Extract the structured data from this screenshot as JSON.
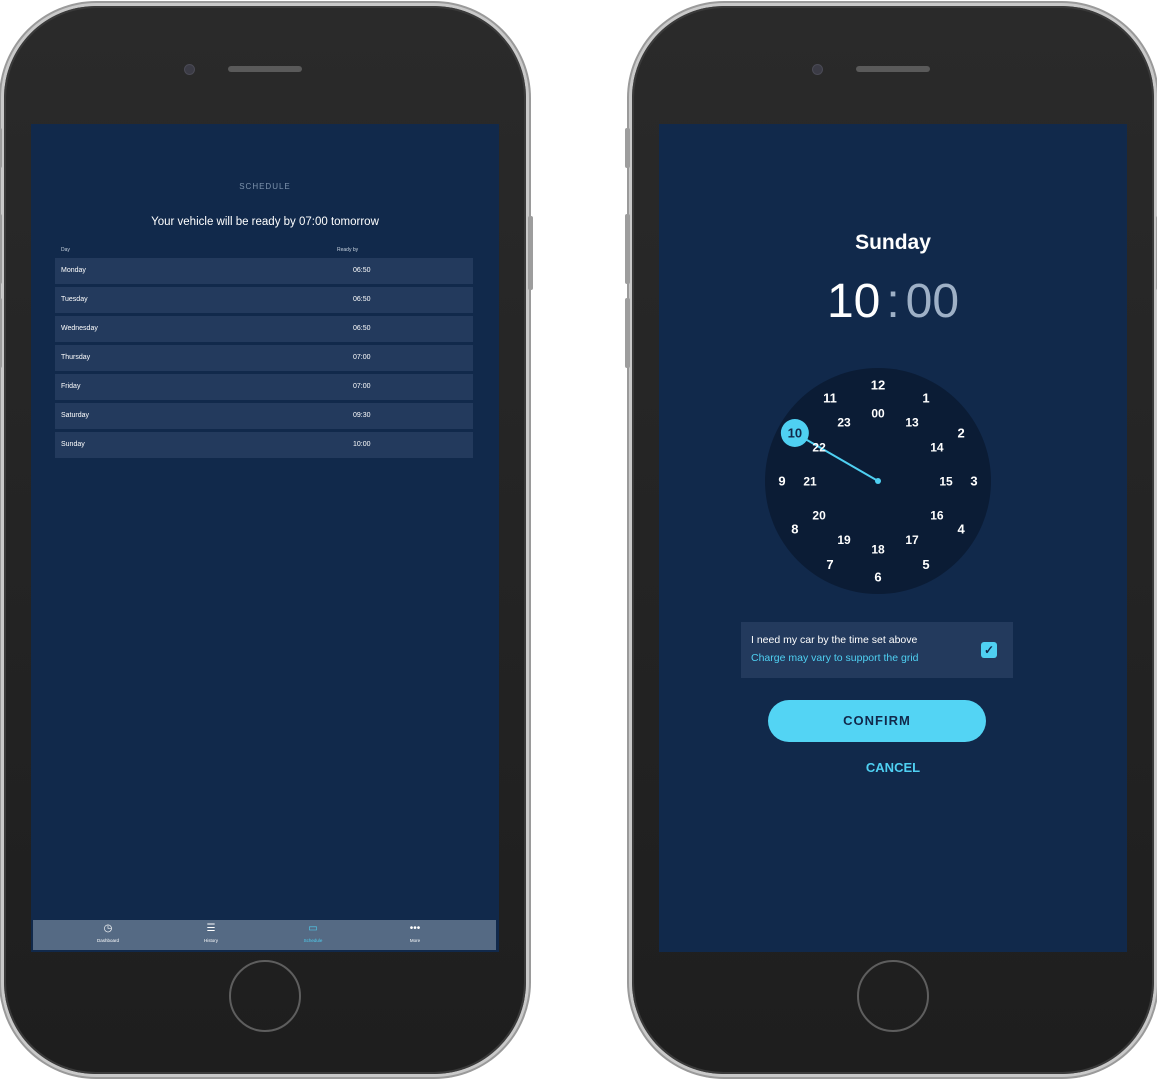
{
  "schedule_screen": {
    "title": "SCHEDULE",
    "headline": "Your vehicle will be ready by 07:00 tomorrow",
    "columns": {
      "day": "Day",
      "ready_by": "Ready by"
    },
    "rows": [
      {
        "day": "Monday",
        "time": "06:50"
      },
      {
        "day": "Tuesday",
        "time": "06:50"
      },
      {
        "day": "Wednesday",
        "time": "06:50"
      },
      {
        "day": "Thursday",
        "time": "07:00"
      },
      {
        "day": "Friday",
        "time": "07:00"
      },
      {
        "day": "Saturday",
        "time": "09:30"
      },
      {
        "day": "Sunday",
        "time": "10:00"
      }
    ],
    "tabs": [
      {
        "label": "Dashboard",
        "icon": "clock-icon",
        "glyph": "◷"
      },
      {
        "label": "History",
        "icon": "list-icon",
        "glyph": "☰"
      },
      {
        "label": "Schedule",
        "icon": "calendar-icon",
        "glyph": "▭"
      },
      {
        "label": "More",
        "icon": "more-icon",
        "glyph": "•••"
      }
    ],
    "active_tab": "Schedule"
  },
  "picker_screen": {
    "day": "Sunday",
    "hour": "10",
    "separator": ":",
    "minute": "00",
    "clock": {
      "outer_numbers": [
        "12",
        "1",
        "2",
        "3",
        "4",
        "5",
        "6",
        "7",
        "8",
        "9",
        "10",
        "11"
      ],
      "inner_numbers": [
        "00",
        "13",
        "14",
        "15",
        "16",
        "17",
        "18",
        "19",
        "20",
        "21",
        "22",
        "23"
      ],
      "selected": "10"
    },
    "need_car_text": "I need my car by the time set above",
    "grid_note": "Charge may vary to support the grid",
    "checkbox_checked": true,
    "checkbox_glyph": "✓",
    "confirm_label": "CONFIRM",
    "cancel_label": "CANCEL"
  },
  "colors": {
    "screen_bg": "#11294b",
    "row_bg": "#233a5d",
    "accent": "#4fd0f2",
    "clock_face": "#0b1c35",
    "tabbar": "#556a84"
  }
}
